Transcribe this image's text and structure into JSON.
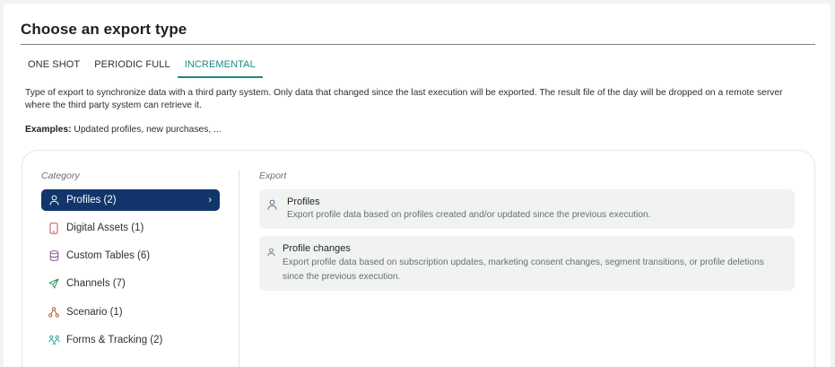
{
  "page": {
    "title": "Choose an export type"
  },
  "tabs": [
    {
      "label": "ONE SHOT",
      "active": false
    },
    {
      "label": "PERIODIC FULL",
      "active": false
    },
    {
      "label": "INCREMENTAL",
      "active": true
    }
  ],
  "description": "Type of export to synchronize data with a third party system. Only data that changed since the last execution will be exported. The result file of the day will be dropped on a remote server where the third party system can retrieve it.",
  "examples": {
    "label": "Examples:",
    "text": " Updated profiles, new purchases, ..."
  },
  "categories_label": "Category",
  "export_label": "Export",
  "categories": [
    {
      "label": "Profiles (2)",
      "icon": "user-icon",
      "active": true
    },
    {
      "label": "Digital Assets (1)",
      "icon": "phone-icon",
      "active": false
    },
    {
      "label": "Custom Tables (6)",
      "icon": "database-icon",
      "active": false
    },
    {
      "label": "Channels (7)",
      "icon": "send-icon",
      "active": false
    },
    {
      "label": "Scenario (1)",
      "icon": "share-icon",
      "active": false
    },
    {
      "label": "Forms & Tracking (2)",
      "icon": "people-icon",
      "active": false
    }
  ],
  "exports": [
    {
      "title": "Profiles",
      "description": "Export profile data based on profiles created and/or updated since the previous execution.",
      "icon": "user-icon"
    },
    {
      "title": "Profile changes",
      "description": "Export profile data based on subscription updates, marketing consent changes, segment transitions, or profile deletions since the previous execution.",
      "icon": "user-icon"
    }
  ],
  "colors": {
    "accent": "#1c8a83",
    "active_category": "#12366b"
  }
}
